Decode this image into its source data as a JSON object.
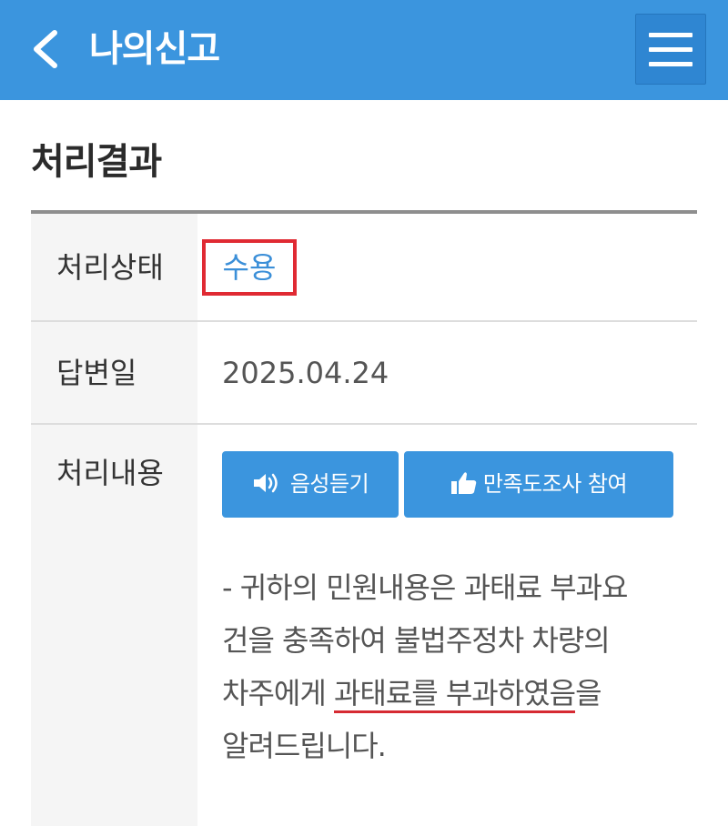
{
  "header": {
    "title": "나의신고"
  },
  "section": {
    "title": "처리결과"
  },
  "rows": {
    "status": {
      "label": "처리상태",
      "value": "수용"
    },
    "answer_date": {
      "label": "답변일",
      "value": "2025.04.24"
    },
    "content": {
      "label": "처리내용",
      "voice_button": "음성듣기",
      "survey_button": "만족도조사 참여",
      "lines": {
        "l1": "- 귀하의 민원내용은 과태료 부과요",
        "l2": "건을 충족하여 불법주정차 차량의",
        "l3_pre": "차주에게 ",
        "l3_underlined": "과태료를 부과하였음",
        "l3_post": "을",
        "l4": "알려드립니다."
      }
    }
  },
  "colors": {
    "header_bg": "#3b95de",
    "status_text": "#3b8fd8",
    "highlight_border": "#e02a33"
  },
  "icons": {
    "back": "chevron-left-icon",
    "menu": "hamburger-menu-icon",
    "voice": "speaker-icon",
    "survey": "thumbs-up-icon"
  }
}
